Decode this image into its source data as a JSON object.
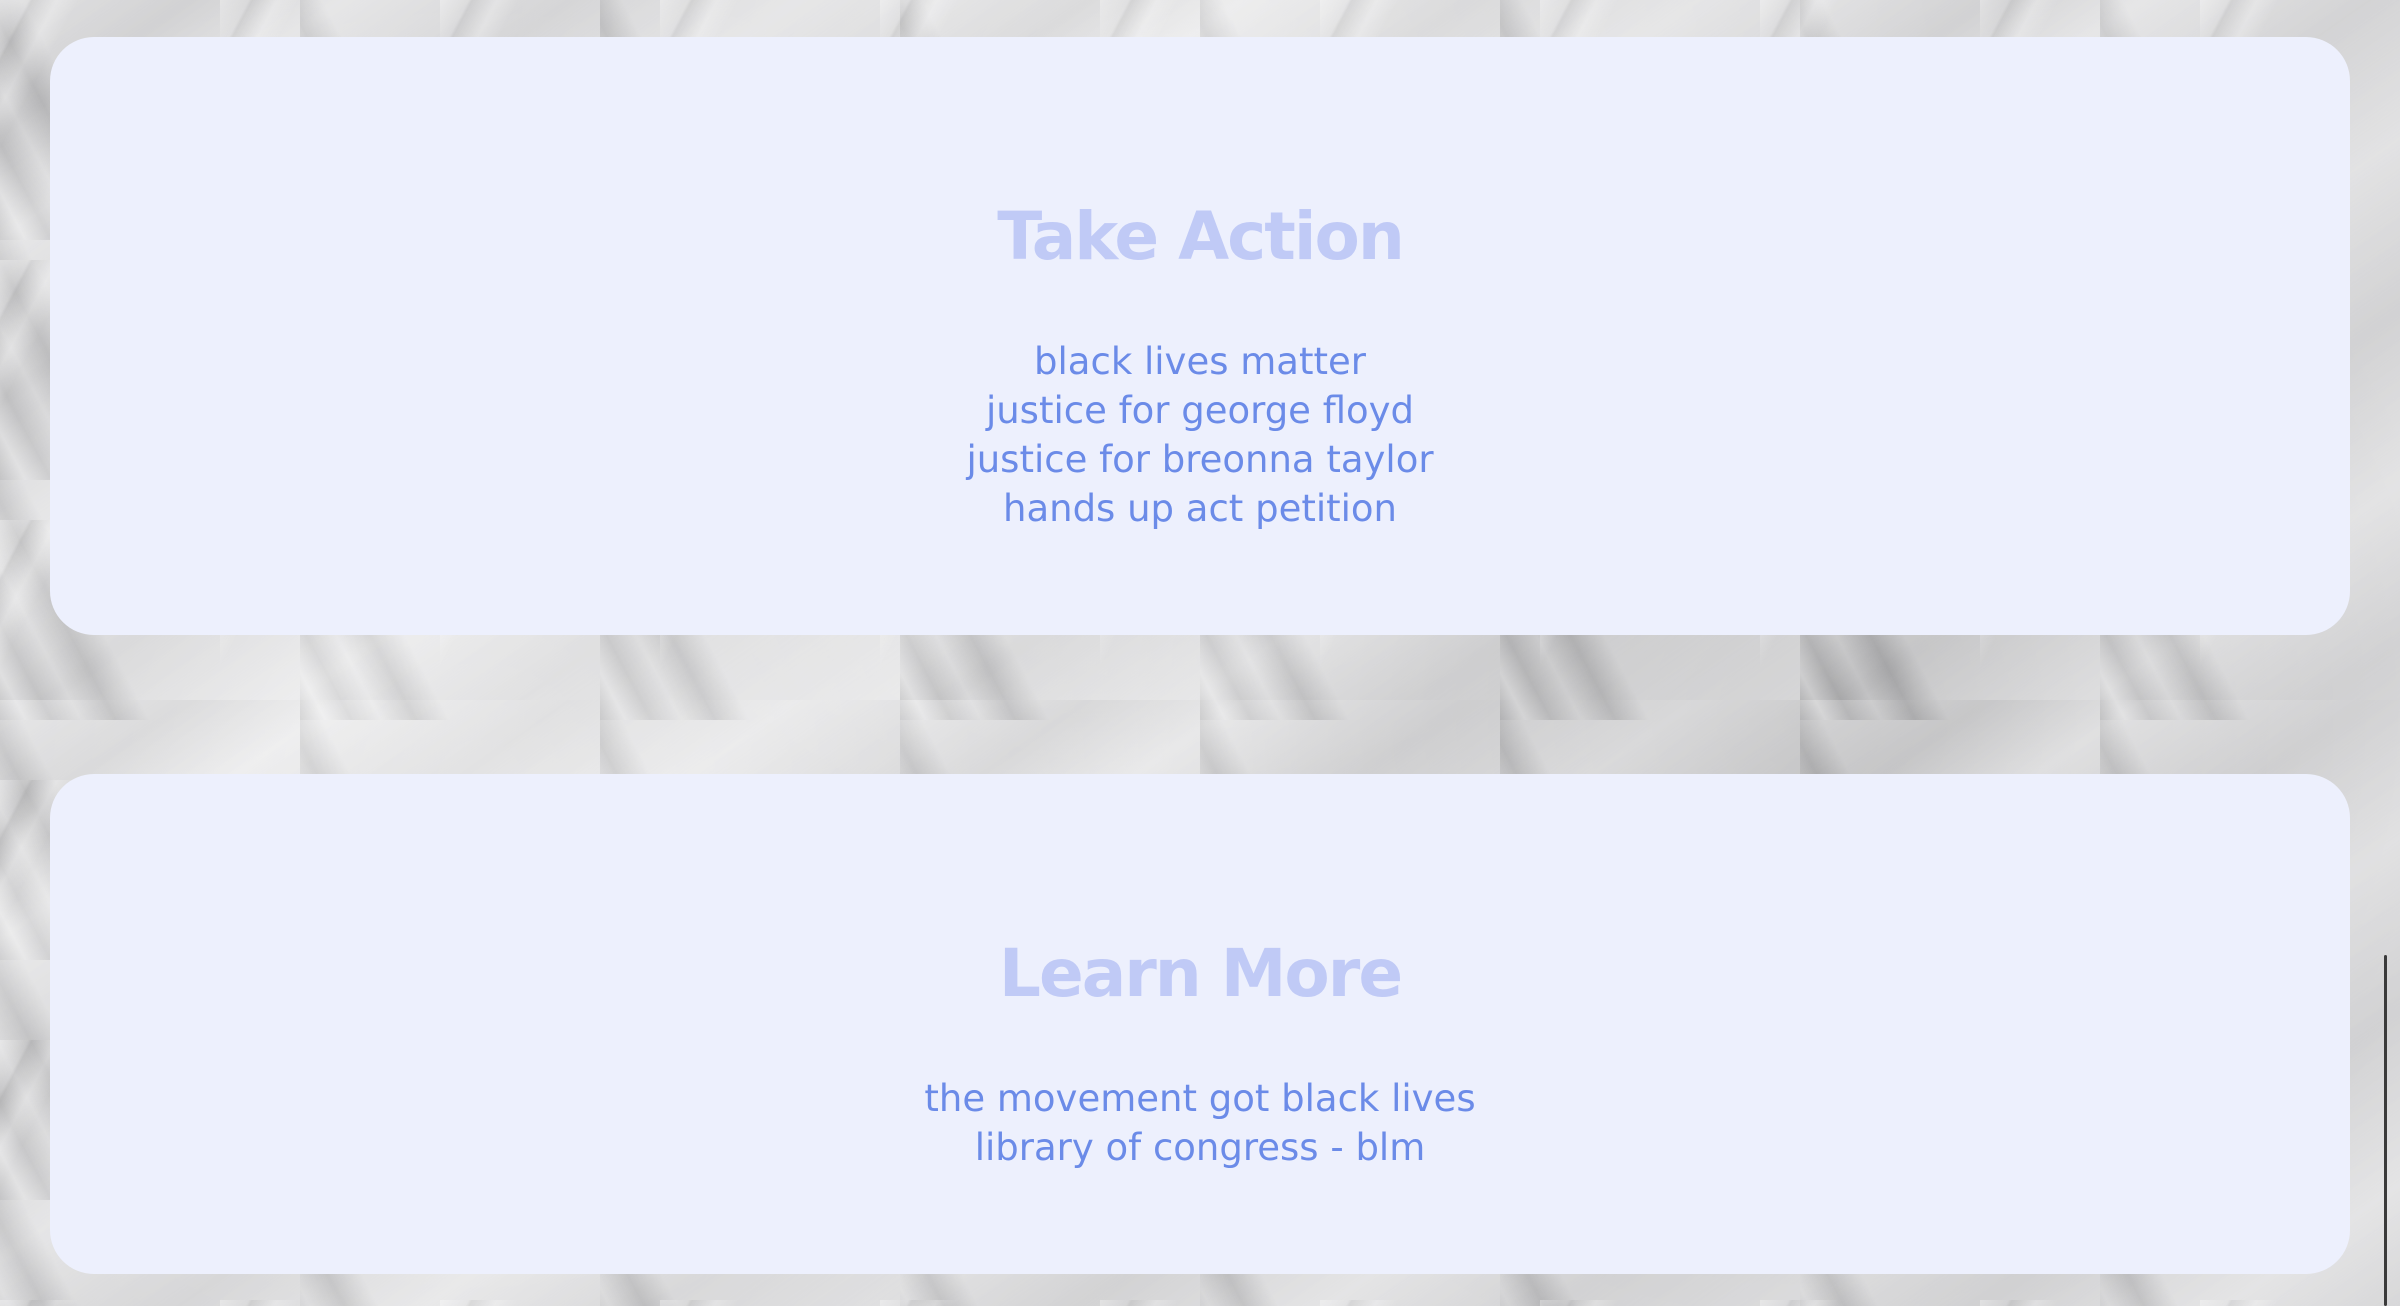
{
  "take_action": {
    "title": "Take Action",
    "links": [
      "black lives matter",
      "justice for george floyd",
      "justice for breonna taylor",
      "hands up act petition"
    ]
  },
  "learn_more": {
    "title": "Learn More",
    "links": [
      "the movement got black lives",
      "library of congress - blm"
    ]
  },
  "colors": {
    "card_background": "#edf0fd",
    "title": "#c0caf6",
    "link": "#6b8be8"
  }
}
